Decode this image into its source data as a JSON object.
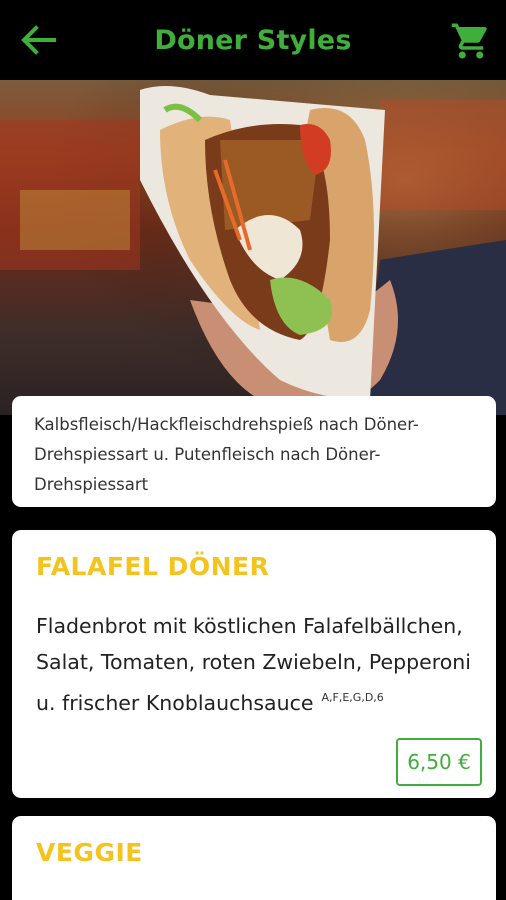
{
  "appbar": {
    "title": "Döner Styles",
    "back_icon": "arrow-left-icon",
    "cart_icon": "shopping-cart-icon",
    "accent": "#3fae3a"
  },
  "intro": {
    "text": "Kalbsfleisch/Hackfleischdrehspieß nach Döner-Drehspiessart u. Putenfleisch nach Döner-Drehspiessart"
  },
  "products": [
    {
      "title": "FALAFEL DÖNER",
      "description": "Fladenbrot mit köstlichen Falafelbällchen, Salat, Tomaten, roten Zwiebeln, Pepperoni u. frischer Knoblauchsauce",
      "allergens": "A,F,E,G,D,6",
      "price": "6,50 €"
    },
    {
      "title": "VEGGIE"
    }
  ],
  "colors": {
    "title_yellow": "#f5c31d",
    "green": "#3fae3a",
    "background": "#000000"
  }
}
